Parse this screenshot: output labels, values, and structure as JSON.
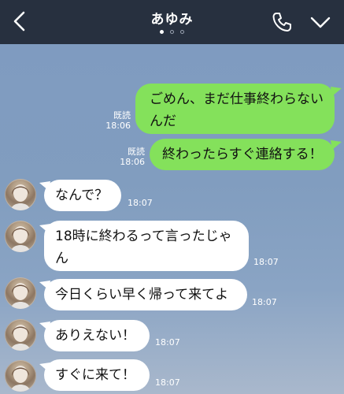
{
  "header": {
    "title": "あゆみ"
  },
  "messages": {
    "sent": [
      {
        "text_line1": "ごめん、まだ仕事終わらない",
        "text_line2": "んだ",
        "read": "既読",
        "time": "18:06"
      },
      {
        "text": "終わったらすぐ連絡する！",
        "read": "既読",
        "time": "18:06"
      }
    ],
    "received": [
      {
        "text": "なんで？",
        "time": "18:07"
      },
      {
        "text_line1": "18時に終わるって言ったじゃ",
        "text_line2": "ん",
        "time": "18:07"
      },
      {
        "text": "今日くらい早く帰って来てよ",
        "time": "18:07"
      },
      {
        "text": "ありえない！",
        "time": "18:07"
      },
      {
        "text": "すぐに来て！",
        "time": "18:07"
      }
    ]
  },
  "colors": {
    "header_bg": "#27303f",
    "chat_bg": "#7f9bbe",
    "sent_bubble": "#84e15b",
    "received_bubble": "#ffffff"
  },
  "icons": [
    "back-arrow-icon",
    "phone-icon",
    "chevron-down-icon"
  ]
}
